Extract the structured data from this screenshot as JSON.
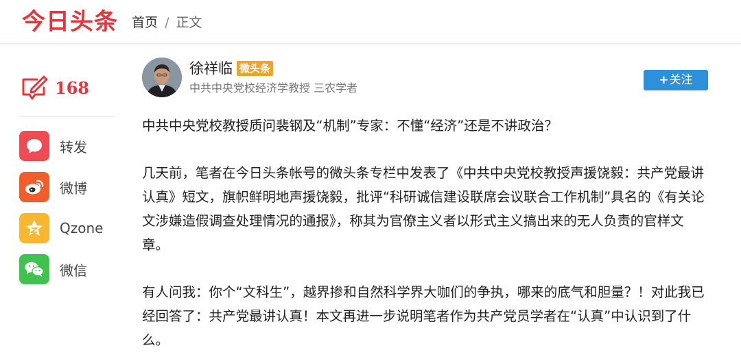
{
  "header": {
    "logo": "今日头条",
    "breadcrumb": {
      "home": "首页",
      "separator": "/",
      "current": "正文"
    }
  },
  "sidebar": {
    "comment_count": "168",
    "share": [
      {
        "label": "转发",
        "icon": "repost-icon",
        "color": "#ef4b55"
      },
      {
        "label": "微博",
        "icon": "weibo-icon",
        "color": "#f25e2b"
      },
      {
        "label": "Qzone",
        "icon": "qzone-icon",
        "color": "#f7b731"
      },
      {
        "label": "微信",
        "icon": "wechat-icon",
        "color": "#3fc24e"
      }
    ]
  },
  "author": {
    "name": "徐祥临",
    "badge": "微头条",
    "description": "中共中央党校经济学教授 三农学者",
    "follow_label": "关注"
  },
  "article": {
    "paragraphs": [
      "中共中央党校教授质问裴钢及“机制”专家：不懂“经济”还是不讲政治？",
      "几天前，笔者在今日头条帐号的微头条专栏中发表了《中共中央党校教授声援饶毅：共产党最讲认真》短文，旗帜鲜明地声援饶毅，批评“科研诚信建设联席会议联合工作机制”具名的《有关论文涉嫌造假调查处理情况的通报》，称其为官僚主义者以形式主义搞出来的无人负责的官样文章。",
      "有人问我：你个“文科生”，越界掺和自然科学界大咖们的争执，哪来的底气和胆量？！对此我已经回答了：共产党最讲认真！本文再进一步说明笔者作为共产党员学者在“认真”中认识到了什么。"
    ]
  },
  "colors": {
    "brand_red": "#e8343b",
    "follow_blue": "#2d90db",
    "badge_orange": "#f0a22a"
  }
}
